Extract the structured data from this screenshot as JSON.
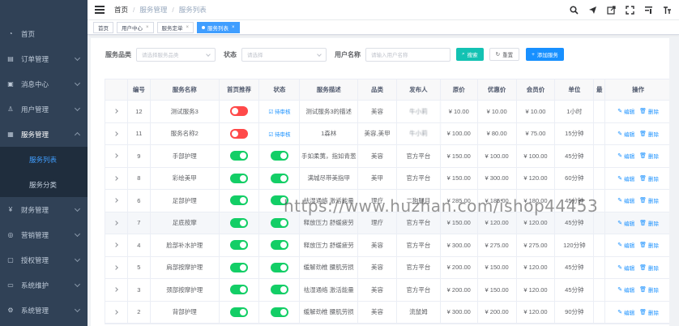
{
  "sidebar": {
    "logo": "",
    "items": [
      {
        "label": "首页",
        "icon": "dashboard-icon",
        "arrow": false
      },
      {
        "label": "订单管理",
        "icon": "order-icon",
        "arrow": true
      },
      {
        "label": "消息中心",
        "icon": "message-icon",
        "arrow": true
      },
      {
        "label": "用户管理",
        "icon": "user-icon",
        "arrow": true
      },
      {
        "label": "服务管理",
        "icon": "service-icon",
        "arrow": true,
        "expanded": true
      },
      {
        "label": "财务管理",
        "icon": "finance-icon",
        "arrow": true
      },
      {
        "label": "营销管理",
        "icon": "marketing-icon",
        "arrow": true
      },
      {
        "label": "授权管理",
        "icon": "auth-icon",
        "arrow": true
      },
      {
        "label": "系统维护",
        "icon": "maintenance-icon",
        "arrow": true
      },
      {
        "label": "系统管理",
        "icon": "settings-icon",
        "arrow": true
      }
    ],
    "sub_items": [
      {
        "label": "服务列表",
        "active": true
      },
      {
        "label": "服务分类",
        "active": false
      }
    ]
  },
  "breadcrumb": [
    "首页",
    "服务管理",
    "服务列表"
  ],
  "nav_icons": [
    "search-icon",
    "send-icon",
    "external-link-icon",
    "fullscreen-icon",
    "menu-icon",
    "text-size-icon"
  ],
  "tags": [
    {
      "label": "首页",
      "active": false,
      "closable": false
    },
    {
      "label": "用户中心",
      "active": false,
      "closable": true
    },
    {
      "label": "服务定单",
      "active": false,
      "closable": true
    },
    {
      "label": "服务列表",
      "active": true,
      "closable": true
    }
  ],
  "search": {
    "category_label": "服务品类",
    "category_placeholder": "请选择服务品类",
    "status_label": "状态",
    "status_placeholder": "请选择",
    "user_label": "用户名称",
    "user_placeholder": "请输入用户名称",
    "search_btn": "搜索",
    "reset_btn": "重置",
    "add_btn": "添加服务"
  },
  "table": {
    "columns": [
      "",
      "编号",
      "服务名称",
      "首页推荐",
      "状态",
      "服务描述",
      "品类",
      "发布人",
      "原价",
      "优惠价",
      "会员价",
      "单位",
      "最",
      "操作"
    ],
    "edit_label": "编辑",
    "delete_label": "删除",
    "rows": [
      {
        "id": "12",
        "name": "测试服务3",
        "recommend": false,
        "status": "待审核",
        "desc": "测试服务3的描述",
        "category": "美容",
        "publisher": "牛小莉",
        "price": "¥ 10.00",
        "discount": "¥ 10.00",
        "member": "¥ 10.00",
        "unit": "1小时"
      },
      {
        "id": "11",
        "name": "服务名称2",
        "recommend": false,
        "status": "待审核",
        "desc": "1森林",
        "category": "美容,美甲",
        "publisher": "牛小莉",
        "price": "¥ 100.00",
        "discount": "¥ 80.00",
        "member": "¥ 75.00",
        "unit": "15分钟"
      },
      {
        "id": "9",
        "name": "手部护理",
        "recommend": true,
        "status": "",
        "desc": "手如柔荑，指如青葱",
        "category": "美容",
        "publisher": "官方平台",
        "price": "¥ 150.00",
        "discount": "¥ 100.00",
        "member": "¥ 100.00",
        "unit": "45分钟"
      },
      {
        "id": "8",
        "name": "彩绘美甲",
        "recommend": true,
        "status": "",
        "desc": "满城尽带美指甲",
        "category": "美甲",
        "publisher": "官方平台",
        "price": "¥ 150.00",
        "discount": "¥ 300.00",
        "member": "¥ 120.00",
        "unit": "60分钟"
      },
      {
        "id": "6",
        "name": "足部护理",
        "recommend": true,
        "status": "",
        "desc": "祛湿通络 激活能量",
        "category": "理疗",
        "publisher": "二狗腿月",
        "price": "¥ 285.00",
        "discount": "¥ 185.00",
        "member": "¥ 180.00",
        "unit": "45分钟"
      },
      {
        "id": "7",
        "name": "足底按摩",
        "recommend": true,
        "status": "",
        "desc": "释放压力 舒缓疲劳",
        "category": "理疗",
        "publisher": "官方平台",
        "price": "¥ 150.00",
        "discount": "¥ 120.00",
        "member": "¥ 120.00",
        "unit": "45分钟"
      },
      {
        "id": "4",
        "name": "脸部补水护理",
        "recommend": true,
        "status": "",
        "desc": "释放压力 舒缓疲劳",
        "category": "美容",
        "publisher": "官方平台",
        "price": "¥ 300.00",
        "discount": "¥ 275.00",
        "member": "¥ 275.00",
        "unit": "120分钟"
      },
      {
        "id": "5",
        "name": "肩部按摩护理",
        "recommend": true,
        "status": "",
        "desc": "缓解劲椎 腰肌劳损",
        "category": "美容",
        "publisher": "官方平台",
        "price": "¥ 200.00",
        "discount": "¥ 150.00",
        "member": "¥ 120.00",
        "unit": "45分钟"
      },
      {
        "id": "3",
        "name": "颈部按摩护理",
        "recommend": true,
        "status": "",
        "desc": "祛湿通络 激活能量",
        "category": "美容",
        "publisher": "官方平台",
        "price": "¥ 200.00",
        "discount": "¥ 150.00",
        "member": "¥ 120.00",
        "unit": "45分钟"
      },
      {
        "id": "2",
        "name": "背部护理",
        "recommend": true,
        "status": "",
        "desc": "缓解劲椎 腰肌劳损",
        "category": "美容",
        "publisher": "流鼠姆",
        "price": "¥ 300.00",
        "discount": "¥ 200.00",
        "member": "¥ 120.00",
        "unit": "90分钟"
      }
    ]
  },
  "watermark": "https://www.huzhan.com/ishop44453",
  "colors": {
    "sidebar_bg": "#304156",
    "accent": "#409eff",
    "switch_on": "#13ce66",
    "switch_off": "#ff4949",
    "search_btn": "#13c2b3"
  }
}
